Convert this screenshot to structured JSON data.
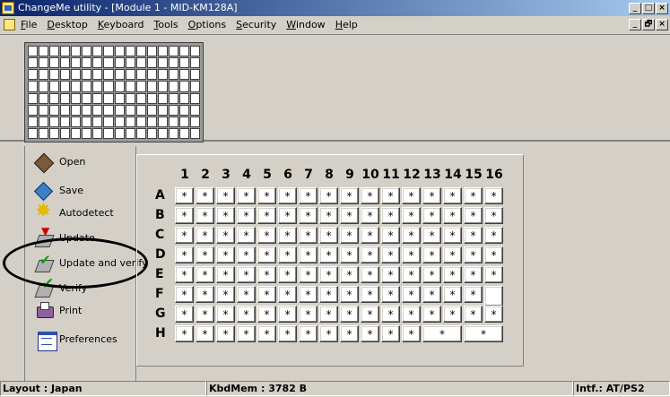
{
  "window": {
    "title": "ChangeMe utility - [Module 1 - MID-KM128A]",
    "controls": [
      "_",
      "□",
      "×"
    ],
    "doc_controls": [
      "_",
      "🗗",
      "×"
    ]
  },
  "menu": [
    {
      "u": "F",
      "rest": "ile"
    },
    {
      "u": "D",
      "rest": "esktop"
    },
    {
      "u": "K",
      "rest": "eyboard"
    },
    {
      "u": "T",
      "rest": "ools"
    },
    {
      "u": "O",
      "rest": "ptions"
    },
    {
      "u": "S",
      "rest": "ecurity"
    },
    {
      "u": "W",
      "rest": "indow"
    },
    {
      "u": "H",
      "rest": "elp"
    }
  ],
  "sidebar": [
    {
      "label": "Open",
      "icon": "open-icon"
    },
    {
      "label": "Save",
      "icon": "save-icon"
    },
    {
      "label": "Autodetect",
      "icon": "autodetect-icon"
    },
    {
      "label": "Update",
      "icon": "update-icon"
    },
    {
      "label": "Update and verify",
      "icon": "update-verify-icon"
    },
    {
      "label": "Verify",
      "icon": "verify-icon"
    },
    {
      "label": "Print",
      "icon": "print-icon"
    },
    {
      "label": "Preferences",
      "icon": "preferences-icon"
    }
  ],
  "keyboard": {
    "columns": [
      "1",
      "2",
      "3",
      "4",
      "5",
      "6",
      "7",
      "8",
      "9",
      "10",
      "11",
      "12",
      "13",
      "14",
      "15",
      "16"
    ],
    "rows": [
      "A",
      "B",
      "C",
      "D",
      "E",
      "F",
      "G",
      "H"
    ],
    "key_label": "*"
  },
  "status": {
    "layout": "Layout : Japan",
    "mem": "KbdMem : 3782 B",
    "interface": "Intf.: AT/PS2"
  }
}
